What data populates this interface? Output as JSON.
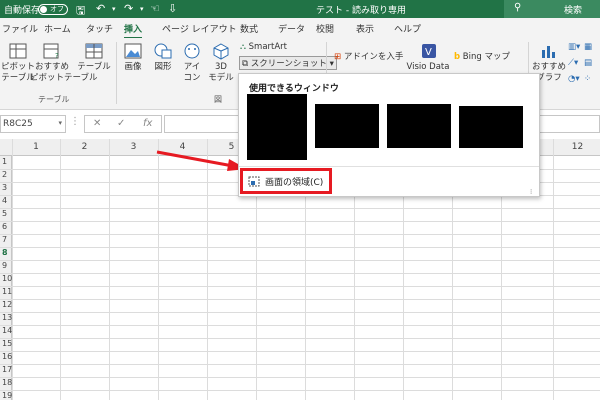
{
  "titlebar": {
    "autosave_label": "自動保存",
    "autosave_state": "オフ",
    "doc_title": "テスト - 読み取り専用",
    "search_label": "検索"
  },
  "tabs": [
    "ファイル",
    "ホーム",
    "タッチ",
    "挿入",
    "ページ レイアウト",
    "数式",
    "データ",
    "校閲",
    "表示",
    "ヘルプ"
  ],
  "active_tab": "挿入",
  "ribbon": {
    "pivot_table": [
      "ピボット",
      "テーブル"
    ],
    "recommended_pivot": [
      "おすすめ",
      "ピボットテーブル"
    ],
    "table": "テーブル",
    "group_tables": "テーブル",
    "image": "画像",
    "shapes": "図形",
    "icons": [
      "アイ",
      "コン"
    ],
    "model3d": [
      "3D",
      "モデル"
    ],
    "group_illustrations": "図",
    "smartart": "SmartArt",
    "screenshot": "スクリーンショット",
    "get_addins": "アドインを入手",
    "visio": "Visio Data",
    "bing_maps": "Bing マップ",
    "recommended_charts": [
      "おすすめ",
      "グラフ"
    ]
  },
  "formula_bar": {
    "name_box": "R8C25",
    "fx": "fx",
    "cancel": "✕",
    "enter": "✓"
  },
  "columns": [
    "1",
    "2",
    "3",
    "4",
    "5",
    "12"
  ],
  "rows": [
    "1",
    "2",
    "3",
    "4",
    "5",
    "6",
    "7",
    "8",
    "9",
    "10",
    "11",
    "12",
    "13",
    "14",
    "15",
    "16",
    "17",
    "18",
    "19"
  ],
  "selected_row": "8",
  "dropdown": {
    "heading": "使用できるウィンドウ",
    "region_label": "画面の領域(C)"
  },
  "colors": {
    "excel_green": "#217346",
    "highlight_red": "#e61a22"
  }
}
